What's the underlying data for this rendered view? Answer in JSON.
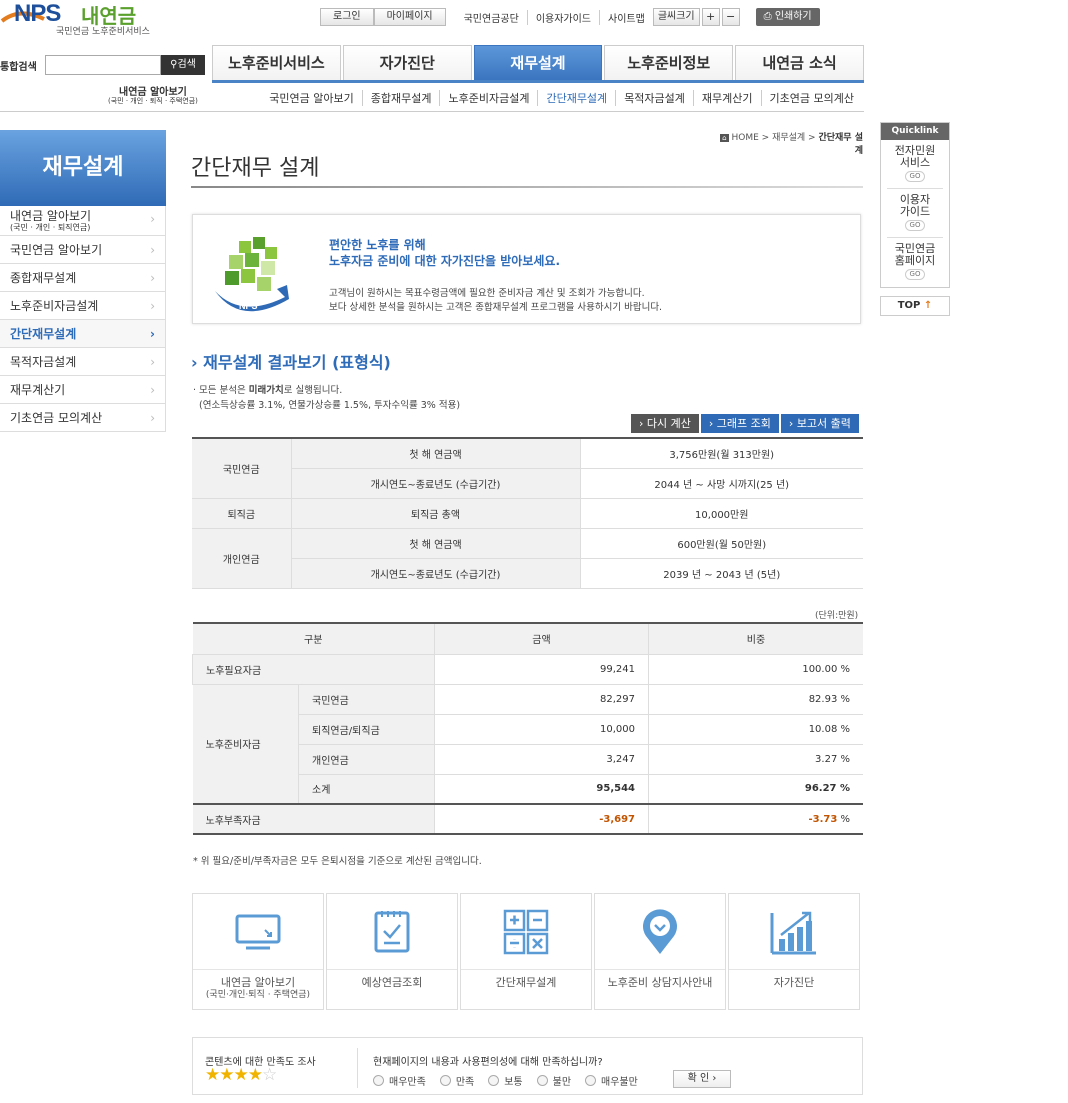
{
  "header": {
    "logo_text": "NPS",
    "logo_kr": "내연금",
    "logo_sub": "국민연금 노후준비서비스",
    "login": "로그인",
    "mypage": "마이페이지",
    "links": [
      "국민연금공단",
      "이용자가이드",
      "사이트맵"
    ],
    "fontsize_label": "글씨크기",
    "plus": "+",
    "minus": "−",
    "print": "인쇄하기"
  },
  "search": {
    "label": "통합검색",
    "button": "검색",
    "value": ""
  },
  "gnb": {
    "tabs": [
      "노후준비서비스",
      "자가진단",
      "재무설계",
      "노후준비정보",
      "내연금 소식"
    ],
    "active": 2
  },
  "subnav": {
    "first_label": "내연금 알아보기",
    "first_sub": "(국민 · 개인 · 퇴직 · 주택연금)",
    "items": [
      "국민연금 알아보기",
      "종합재무설계",
      "노후준비자금설계",
      "간단재무설계",
      "목적자금설계",
      "재무계산기",
      "기초연금 모의계산"
    ],
    "active": 3
  },
  "lnb": {
    "title": "재무설계",
    "items": [
      {
        "label": "내연금 알아보기",
        "sub": "(국민 · 개인 · 퇴직연금)"
      },
      {
        "label": "국민연금 알아보기"
      },
      {
        "label": "종합재무설계"
      },
      {
        "label": "노후준비자금설계"
      },
      {
        "label": "간단재무설계",
        "active": true
      },
      {
        "label": "목적자금설계"
      },
      {
        "label": "재무계산기"
      },
      {
        "label": "기초연금 모의계산"
      }
    ]
  },
  "quicklink": {
    "title": "Quicklink",
    "items": [
      {
        "l1": "전자민원",
        "l2": "서비스"
      },
      {
        "l1": "이용자",
        "l2": "가이드"
      },
      {
        "l1": "국민연금",
        "l2": "홈페이지"
      }
    ],
    "go": "GO",
    "top": "TOP"
  },
  "breadcrumb": {
    "home": "HOME",
    "mid": "재무설계",
    "current": "간단재무 설계"
  },
  "page_title": "간단재무 설계",
  "intro": {
    "headline1": "편안한 노후를 위해",
    "headline2": "노후자금 준비에 대한 자가진단을 받아보세요.",
    "body1": "고객님이 원하시는 목표수령금액에 필요한 준비자금 계산 및 조회가 가능합니다.",
    "body2": "보다 상세한 분석을 원하시는 고객은 종합재무설계 프로그램을 사용하시기 바랍니다."
  },
  "section": {
    "title": "재무설계 결과보기 (표형식)",
    "note_a": "모든 분석은 ",
    "note_b": "미래가치",
    "note_c": "로 실행됩니다.",
    "note2": "(연소득상승률 3.1%, 연물가상승률 1.5%, 투자수익률 3% 적용)",
    "buttons": [
      "다시 계산",
      "그래프 조회",
      "보고서 출력"
    ]
  },
  "table1": {
    "np_label": "국민연금",
    "np_first_label": "첫 해 연금액",
    "np_first_value": "3,756만원(월 313만원)",
    "np_period_label": "개시연도~종료년도 (수급기간)",
    "np_period_value": "2044 년 ~ 사망 시까지(25 년)",
    "ret_label": "퇴직금",
    "ret_total_label": "퇴직금 총액",
    "ret_total_value": "10,000만원",
    "pp_label": "개인연금",
    "pp_first_label": "첫 해 연금액",
    "pp_first_value": "600만원(월 50만원)",
    "pp_period_label": "개시연도~종료년도 (수급기간)",
    "pp_period_value": "2039 년 ~ 2043 년 (5년)"
  },
  "unit": "(단위:만원)",
  "table2": {
    "headers": [
      "구분",
      "금액",
      "비중"
    ],
    "need_label": "노후필요자금",
    "need_amount": "99,241",
    "need_ratio": "100.00 %",
    "prep_label": "노후준비자금",
    "rows": [
      {
        "label": "국민연금",
        "amount": "82,297",
        "ratio": "82.93 %"
      },
      {
        "label": "퇴직연금/퇴직금",
        "amount": "10,000",
        "ratio": "10.08 %"
      },
      {
        "label": "개인연금",
        "amount": "3,247",
        "ratio": "3.27 %"
      },
      {
        "label": "소계",
        "amount": "95,544",
        "ratio": "96.27 %"
      }
    ],
    "short_label": "노후부족자금",
    "short_amount": "-3,697",
    "short_ratio_num": "-3.73",
    "short_ratio_unit": " %"
  },
  "note_bottom": "위 필요/준비/부족자금은 모두 은퇴시점을 기준으로 계산된 금액입니다.",
  "shortcuts": [
    {
      "label": "내연금 알아보기",
      "sub": "(국민·개인·퇴직 · 주택연금)",
      "icon": "monitor-icon"
    },
    {
      "label": "예상연금조회",
      "icon": "checklist-icon"
    },
    {
      "label": "간단재무설계",
      "icon": "calculator-icon"
    },
    {
      "label": "노후준비 상담지사안내",
      "icon": "location-pin-icon"
    },
    {
      "label": "자가진단",
      "icon": "bar-chart-icon"
    }
  ],
  "survey": {
    "title": "콘텐츠에 대한 만족도 조사",
    "rating_stars": 4,
    "rating_max": 5,
    "question": "현재페이지의 내용과 사용편의성에 대해 만족하십니까?",
    "options": [
      "매우만족",
      "만족",
      "보통",
      "불만",
      "매우불만"
    ],
    "confirm": "확 인"
  },
  "colors": {
    "brand_blue": "#2e6bb8",
    "accent_orange": "#c25400",
    "star": "#f0b400"
  }
}
